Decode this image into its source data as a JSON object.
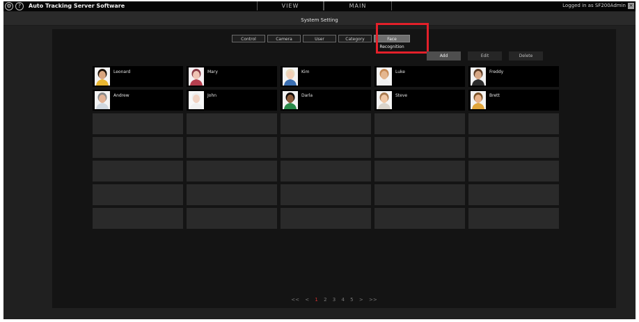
{
  "app": {
    "title": "Auto Tracking Server Software",
    "settings_icon": "gear-icon",
    "help_label": "?",
    "logged_in_text": "Logged in as SF200Admin",
    "logout_label": "×"
  },
  "main_tabs": [
    {
      "label": "VIEW"
    },
    {
      "label": "MAIN"
    }
  ],
  "page_title": "System Setting",
  "settings_tabs": [
    {
      "label": "Control"
    },
    {
      "label": "Camera"
    },
    {
      "label": "User"
    },
    {
      "label": "Category"
    },
    {
      "label": "Face Recognition",
      "active": true
    }
  ],
  "actions": {
    "add": "Add",
    "edit": "Edit",
    "delete": "Delete"
  },
  "people": [
    {
      "name": "Leonard",
      "skin": "#d9a57e",
      "hair": "#1d1208",
      "shirt": "#e8b630",
      "bg": "#f3f3f3"
    },
    {
      "name": "Mary",
      "skin": "#efc4b4",
      "hair": "#8a3b45",
      "shirt": "#b73f4f",
      "bg": "#f6f0f2"
    },
    {
      "name": "Kim",
      "skin": "#f1cfb6",
      "hair": "#e8dcc0",
      "shirt": "#3a6fb2",
      "bg": "#f4f4f4"
    },
    {
      "name": "Luke",
      "skin": "#e4b790",
      "hair": "#c68a55",
      "shirt": "#f0f0f0",
      "bg": "#f5f5f5"
    },
    {
      "name": "Freddy",
      "skin": "#d7a886",
      "hair": "#5a3a24",
      "shirt": "#2b2b2b",
      "bg": "#f2f2f2"
    },
    {
      "name": "Andrew",
      "skin": "#e2b396",
      "hair": "#8a8a8a",
      "shirt": "#d0d8e0",
      "bg": "#f4f4f4"
    },
    {
      "name": "John",
      "skin": "#f0d2c2",
      "hair": "#efefef",
      "shirt": "#f0f0f0",
      "bg": "#f8f8f8"
    },
    {
      "name": "Darla",
      "skin": "#8a5a3a",
      "hair": "#0c0806",
      "shirt": "#2a8a4a",
      "bg": "#f2f2f2"
    },
    {
      "name": "Steve",
      "skin": "#f0c8a6",
      "hair": "#a87a50",
      "shirt": "#d9d4cc",
      "bg": "#f5f5f5"
    },
    {
      "name": "Brett",
      "skin": "#e7b28a",
      "hair": "#7a5228",
      "shirt": "#e1a53a",
      "bg": "#f3f3f3"
    }
  ],
  "pagination": {
    "first": "<<",
    "prev": "<",
    "pages": [
      "1",
      "2",
      "3",
      "4",
      "5"
    ],
    "current": "1",
    "next": ">",
    "last": ">>"
  },
  "colors": {
    "highlight": "#e3202a",
    "current_page": "#d53030"
  }
}
